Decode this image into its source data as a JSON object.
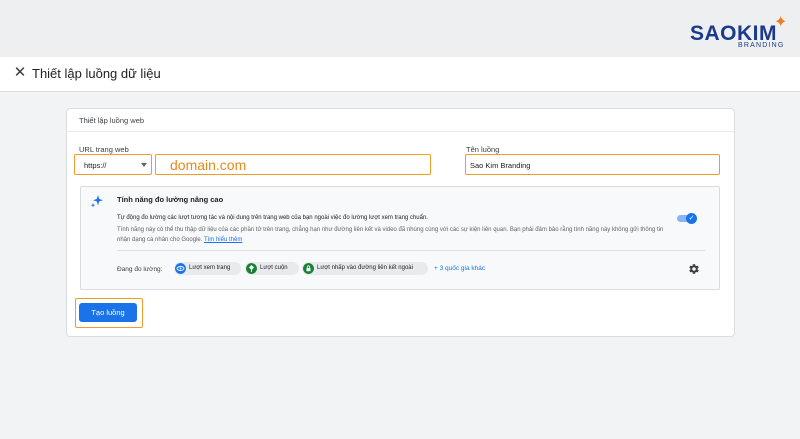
{
  "brand": {
    "logo_main": "SAOKIM",
    "logo_sub": "BRANDING"
  },
  "header": {
    "title": "Thiết lập luồng dữ liệu"
  },
  "card": {
    "title": "Thiết lập luồng web",
    "url_label": "URL trang web",
    "protocol_value": "https://",
    "domain_value": "domain.com",
    "stream_name_label": "Tên luồng",
    "stream_name_value": "Sao Kim Branding"
  },
  "enhanced": {
    "title": "Tính năng đo lường nâng cao",
    "desc_line1": "Tự động đo lường các lượt tương tác và nội dung trên trang web của bạn ngoài việc đo lường lượt xem trang chuẩn.",
    "desc_line2": "Tính năng này có thể thu thập dữ liệu của các phần tử trên trang, chẳng hạn như đường liên kết và video đã nhúng cùng với các sự kiện liên quan. Bạn phải đảm bảo rằng tính năng này không gửi thông tin nhận dạng cá nhân cho Google.",
    "learn_more": "Tìm hiểu thêm",
    "toggle_on": true,
    "measuring_label": "Đang đo lường:",
    "chips": [
      {
        "label": "Lượt xem trang",
        "icon": "eye-icon",
        "color": "#1a73e8"
      },
      {
        "label": "Lượt cuộn",
        "icon": "scroll-icon",
        "color": "#188038"
      },
      {
        "label": "Lượt nhấp vào đường liên kết ngoài",
        "icon": "lock-icon",
        "color": "#188038"
      }
    ],
    "more_link": "+ 3 quốc gia khác"
  },
  "actions": {
    "create_label": "Tạo luồng"
  },
  "colors": {
    "accent": "#1a73e8",
    "highlight": "#f29b29",
    "brand": "#1b3a8c"
  }
}
